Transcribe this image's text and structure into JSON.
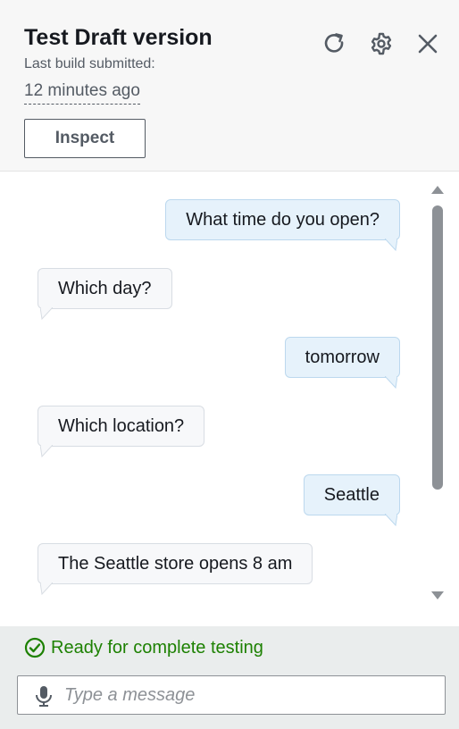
{
  "header": {
    "title": "Test Draft version",
    "subtitle": "Last build submitted:",
    "time_ago": "12 minutes ago",
    "inspect_label": "Inspect"
  },
  "icons": {
    "refresh": "refresh-icon",
    "settings": "gear-icon",
    "close": "close-icon"
  },
  "conversation": [
    {
      "role": "user",
      "text": "What time do you open?"
    },
    {
      "role": "bot",
      "text": "Which day?"
    },
    {
      "role": "user",
      "text": "tomorrow"
    },
    {
      "role": "bot",
      "text": "Which location?"
    },
    {
      "role": "user",
      "text": "Seattle"
    },
    {
      "role": "bot",
      "text": "The Seattle store opens 8 am"
    }
  ],
  "footer": {
    "status": "Ready for complete testing",
    "input_placeholder": "Type a message"
  },
  "colors": {
    "status_green": "#1d8102",
    "user_bubble": "#e6f2fb",
    "bot_bubble": "#f7f8fa",
    "footer_bg": "#eaeded"
  }
}
